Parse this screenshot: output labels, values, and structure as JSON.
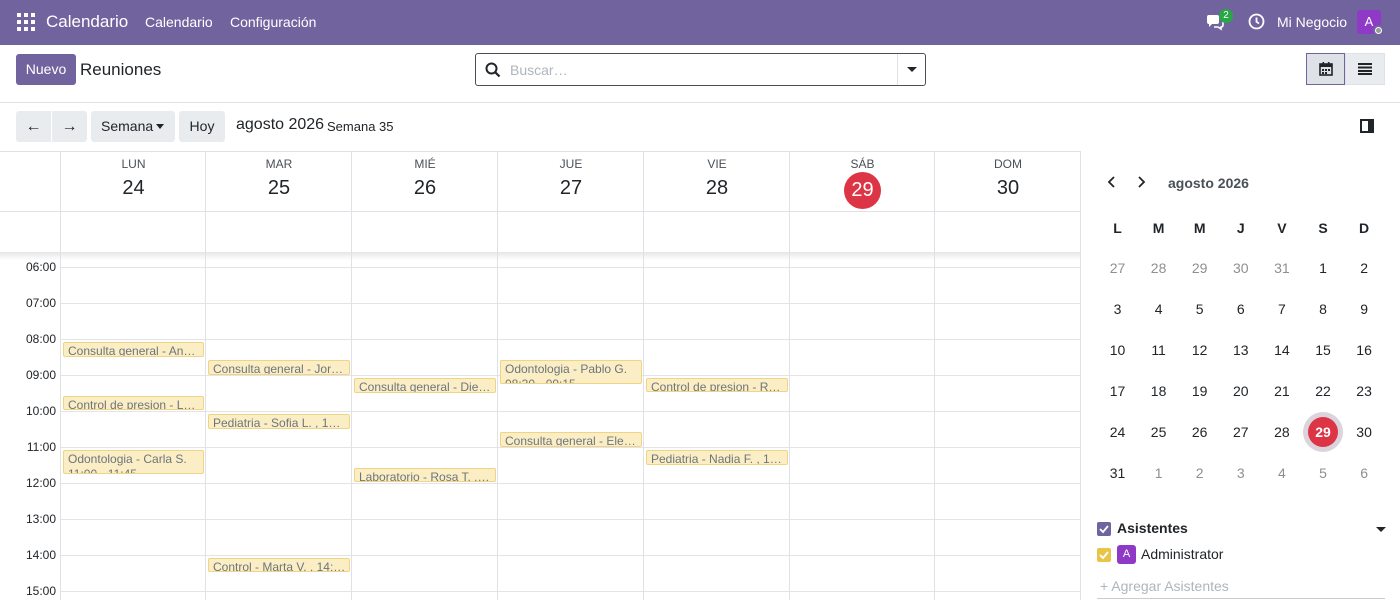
{
  "navbar": {
    "app_name": "Calendario",
    "menus": [
      "Calendario",
      "Configuración"
    ],
    "chat_count": "2",
    "company": "Mi Negocio",
    "avatar_letter": "A"
  },
  "control": {
    "new_label": "Nuevo",
    "title": "Reuniones",
    "search_placeholder": "Buscar…"
  },
  "toolbar": {
    "prev": "←",
    "next": "→",
    "scale": "Semana",
    "today": "Hoy",
    "period": "agosto 2026",
    "week": "Semana 35"
  },
  "days": [
    {
      "name": "LUN",
      "num": "24",
      "today": false
    },
    {
      "name": "MAR",
      "num": "25",
      "today": false
    },
    {
      "name": "MIÉ",
      "num": "26",
      "today": false
    },
    {
      "name": "JUE",
      "num": "27",
      "today": false
    },
    {
      "name": "VIE",
      "num": "28",
      "today": false
    },
    {
      "name": "SÁB",
      "num": "29",
      "today": true
    },
    {
      "name": "DOM",
      "num": "30",
      "today": false
    }
  ],
  "hours": [
    "06:00",
    "07:00",
    "08:00",
    "09:00",
    "10:00",
    "11:00",
    "12:00",
    "13:00",
    "14:00",
    "15:00"
  ],
  "events": [
    {
      "day": 0,
      "start": 8.0,
      "end": 8.5,
      "title": "Consulta general - An…",
      "sub": ""
    },
    {
      "day": 0,
      "start": 9.5,
      "end": 9.9,
      "title": "Control de presion - L…",
      "sub": ""
    },
    {
      "day": 0,
      "start": 11.0,
      "end": 11.75,
      "title": "Odontologia - Carla S.",
      "sub": "11:00 - 11:45"
    },
    {
      "day": 1,
      "start": 8.5,
      "end": 9.0,
      "title": "Consulta general - Jor…",
      "sub": ""
    },
    {
      "day": 1,
      "start": 10.0,
      "end": 10.5,
      "title": "Pediatria - Sofia L. , 1…",
      "sub": ""
    },
    {
      "day": 1,
      "start": 14.0,
      "end": 14.4,
      "title": "Control - Marta V. , 14:…",
      "sub": ""
    },
    {
      "day": 2,
      "start": 9.0,
      "end": 9.5,
      "title": "Consulta general - Die…",
      "sub": ""
    },
    {
      "day": 2,
      "start": 11.5,
      "end": 11.9,
      "title": "Laboratorio - Rosa T. ,…",
      "sub": ""
    },
    {
      "day": 3,
      "start": 8.5,
      "end": 9.25,
      "title": "Odontologia - Pablo G.",
      "sub": "08:30 - 09:15"
    },
    {
      "day": 3,
      "start": 10.5,
      "end": 11.0,
      "title": "Consulta general - Ele…",
      "sub": ""
    },
    {
      "day": 4,
      "start": 9.0,
      "end": 9.4,
      "title": "Control de presion - R…",
      "sub": ""
    },
    {
      "day": 4,
      "start": 11.0,
      "end": 11.5,
      "title": "Pediatria - Nadia F. , 1…",
      "sub": ""
    }
  ],
  "mini_calendar": {
    "title": "agosto 2026",
    "weekdays": [
      "L",
      "M",
      "M",
      "J",
      "V",
      "S",
      "D"
    ],
    "weeks": [
      [
        [
          "27",
          true
        ],
        [
          "28",
          true
        ],
        [
          "29",
          true
        ],
        [
          "30",
          true
        ],
        [
          "31",
          true
        ],
        [
          "1",
          false
        ],
        [
          "2",
          false
        ]
      ],
      [
        [
          "3",
          false
        ],
        [
          "4",
          false
        ],
        [
          "5",
          false
        ],
        [
          "6",
          false
        ],
        [
          "7",
          false
        ],
        [
          "8",
          false
        ],
        [
          "9",
          false
        ]
      ],
      [
        [
          "10",
          false
        ],
        [
          "11",
          false
        ],
        [
          "12",
          false
        ],
        [
          "13",
          false
        ],
        [
          "14",
          false
        ],
        [
          "15",
          false
        ],
        [
          "16",
          false
        ]
      ],
      [
        [
          "17",
          false
        ],
        [
          "18",
          false
        ],
        [
          "19",
          false
        ],
        [
          "20",
          false
        ],
        [
          "21",
          false
        ],
        [
          "22",
          false
        ],
        [
          "23",
          false
        ]
      ],
      [
        [
          "24",
          false
        ],
        [
          "25",
          false
        ],
        [
          "26",
          false
        ],
        [
          "27",
          false
        ],
        [
          "28",
          false
        ],
        [
          "29",
          false
        ],
        [
          "30",
          false
        ]
      ],
      [
        [
          "31",
          false
        ],
        [
          "1",
          true
        ],
        [
          "2",
          true
        ],
        [
          "3",
          true
        ],
        [
          "4",
          true
        ],
        [
          "5",
          true
        ],
        [
          "6",
          true
        ]
      ]
    ],
    "today": "29"
  },
  "filters": {
    "title": "Asistentes",
    "attendee_name": "Administrator",
    "attendee_initial": "A",
    "add_label": "+ Agregar Asistentes"
  },
  "colors": {
    "brand": "#71639e",
    "today": "#dc3545",
    "event_bg": "#fbeec4",
    "filter_all": "#71639e",
    "filter_attendee": "#e8c547"
  }
}
